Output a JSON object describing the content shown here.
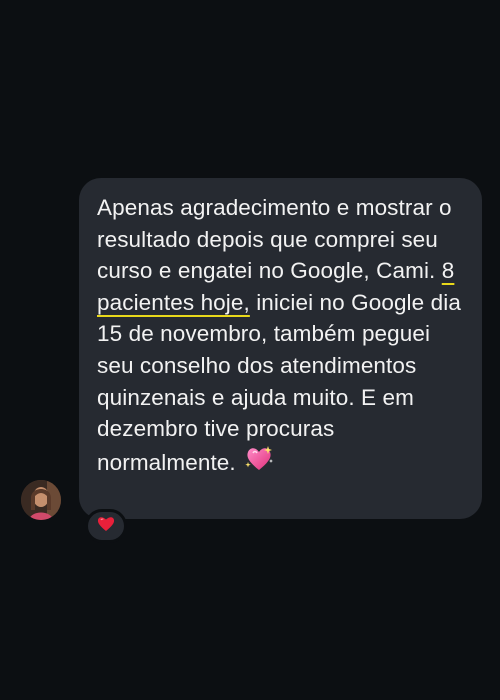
{
  "message": {
    "segments": {
      "before": "Apenas agradecimento e mostrar o resultado depois que comprei seu curso e engatei no Google, Cami. ",
      "highlight": "8 pacientes hoje,",
      "after": " iniciei no Google dia 15 de novembro, também peguei seu conselho dos atendimentos quinzenais e ajuda muito. E em dezembro tive procuras normalmente. "
    },
    "emoji": "sparkling-heart-icon"
  },
  "reaction": {
    "emoji": "red-heart-icon"
  },
  "colors": {
    "background": "#0c0f12",
    "bubble": "#262a31",
    "text": "#f2f2f2",
    "underline": "#e8d81a",
    "heart": "#e8203a",
    "sparkling_heart": "#ff5aa8"
  }
}
